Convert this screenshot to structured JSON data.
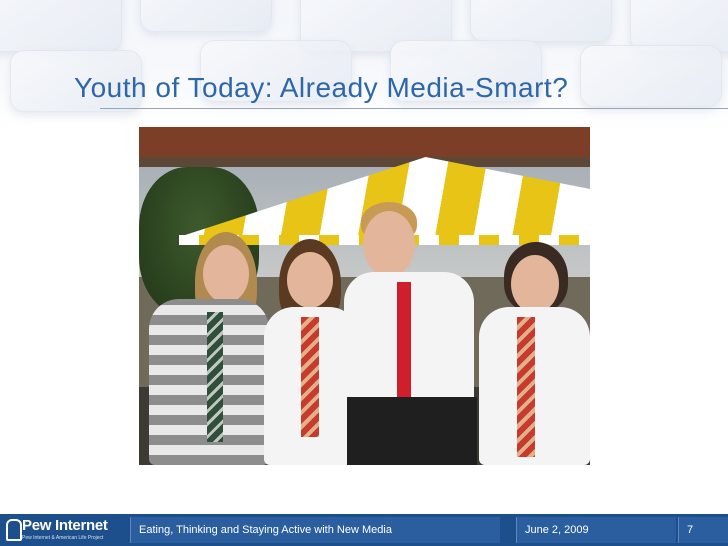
{
  "slide": {
    "title": "Youth of Today: Already Media-Smart?",
    "photo_alt": "Four teenagers in white shirts and ties posing in front of a yellow and white tent"
  },
  "footer": {
    "logo_name": "Pew Internet",
    "logo_subtitle": "Pew Internet & American Life Project",
    "presentation_title": "Eating, Thinking and Staying Active with New Media",
    "date": "June 2, 2009",
    "page_number": "7"
  },
  "colors": {
    "title": "#2e67a7",
    "footer_bar": "#1d4f8c",
    "tent_yellow": "#e8c417"
  }
}
